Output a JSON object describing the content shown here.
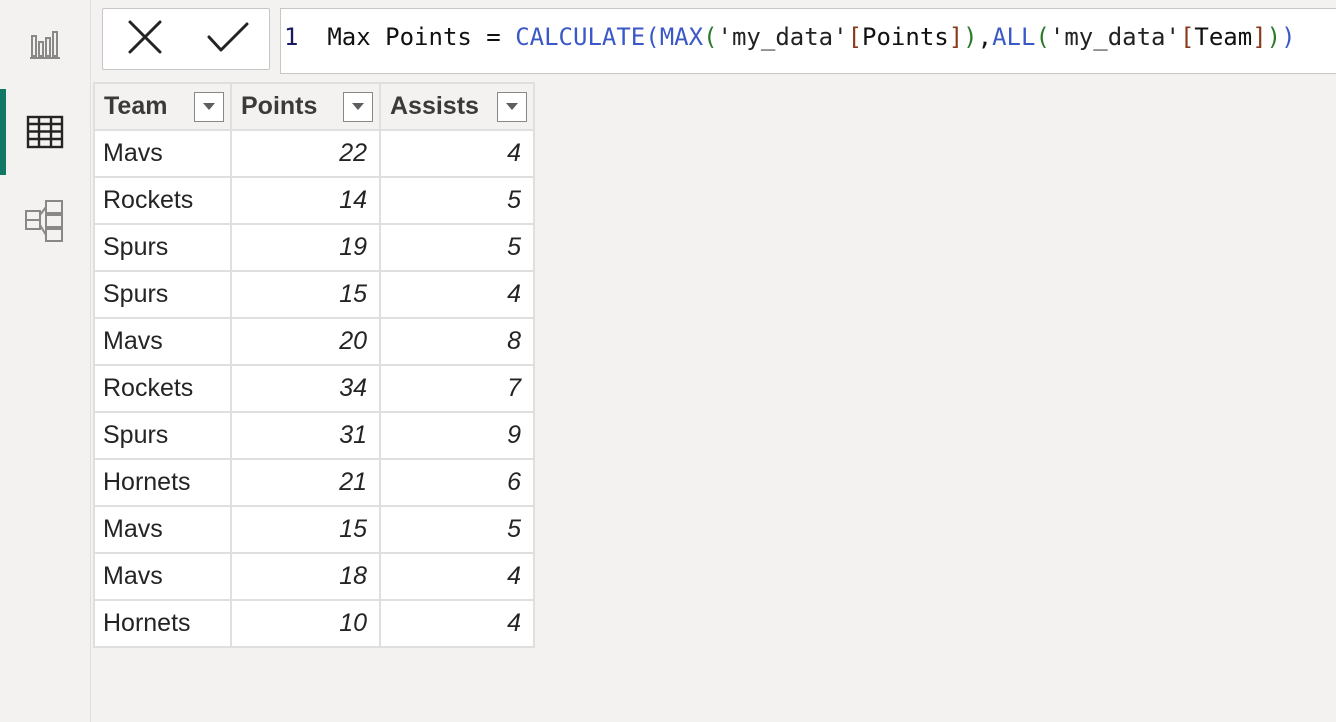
{
  "nav": {
    "items": [
      {
        "name": "report-view",
        "icon": "bar-chart-icon"
      },
      {
        "name": "data-view",
        "icon": "table-grid-icon",
        "active": true
      },
      {
        "name": "model-view",
        "icon": "model-diagram-icon"
      }
    ],
    "accent": "#117865"
  },
  "formula_bar": {
    "line_number": "1",
    "parts": {
      "measure": "Max Points = ",
      "calculate": "CALCULATE",
      "open1": "(",
      "max": "MAX",
      "open2": "(",
      "table1": "'my_data'",
      "open3": "[",
      "col1": "Points",
      "close3": "]",
      "close2": ")",
      "comma": ",",
      "all": "ALL",
      "open4": "(",
      "table2": "'my_data'",
      "open5": "[",
      "col2": "Team",
      "close5": "]",
      "close4": ")",
      "close1": ")"
    }
  },
  "table": {
    "columns": [
      "Team",
      "Points",
      "Assists"
    ],
    "rows": [
      [
        "Mavs",
        "22",
        "4"
      ],
      [
        "Rockets",
        "14",
        "5"
      ],
      [
        "Spurs",
        "19",
        "5"
      ],
      [
        "Spurs",
        "15",
        "4"
      ],
      [
        "Mavs",
        "20",
        "8"
      ],
      [
        "Rockets",
        "34",
        "7"
      ],
      [
        "Spurs",
        "31",
        "9"
      ],
      [
        "Hornets",
        "21",
        "6"
      ],
      [
        "Mavs",
        "15",
        "5"
      ],
      [
        "Mavs",
        "18",
        "4"
      ],
      [
        "Hornets",
        "10",
        "4"
      ]
    ]
  }
}
